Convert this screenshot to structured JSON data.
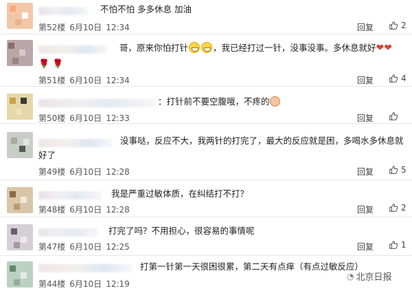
{
  "comments": [
    {
      "text": "不怕不怕  多多休息  加油",
      "floor": "第52楼",
      "date": "6月10日",
      "time": "12:34",
      "reply": "回复",
      "likes": "2"
    },
    {
      "text1": "哥，原来你怕打针",
      "text2": "，我已经打过一针，没事没事。多休息就好",
      "floor": "第51楼",
      "date": "6月10日",
      "time": "12:34",
      "reply": "回复",
      "likes": "4"
    },
    {
      "text": "：打针前不要空腹哦，不疼的",
      "floor": "第50楼",
      "date": "6月10日",
      "time": "12:33",
      "reply": "回复",
      "likes": ""
    },
    {
      "text_line1": "没事哒，反应不大，我两针的打完了，最大的反应就是困，多喝水多休息就",
      "text_line2": "好了",
      "floor": "第49楼",
      "date": "6月10日",
      "time": "12:28",
      "reply": "回复",
      "likes": "5"
    },
    {
      "text": "我是严重过敏体质，在纠结打不打？",
      "floor": "第48楼",
      "date": "6月10日",
      "time": "12:28",
      "reply": "回复",
      "likes": "2"
    },
    {
      "text": "打完了吗？不用担心，很容易的事情呢",
      "floor": "第47楼",
      "date": "6月10日",
      "time": "12:25",
      "reply": "回复",
      "likes": "1"
    },
    {
      "text": "打第一针第一天很困很累，第二天有点痒（有点过敏反应）",
      "floor": "第44楼",
      "date": "6月10日",
      "time": "12:19",
      "reply": "回复",
      "likes": ""
    }
  ],
  "emojis": {
    "grin": "grin-emoji",
    "heart": "❤",
    "rose": "🌹",
    "shy": "shy-emoji"
  },
  "watermark": {
    "text": "北京日报"
  },
  "colors": {
    "text": "#222222",
    "meta": "#555555",
    "divider": "#e6e6e6",
    "heart": "#e0402c"
  }
}
